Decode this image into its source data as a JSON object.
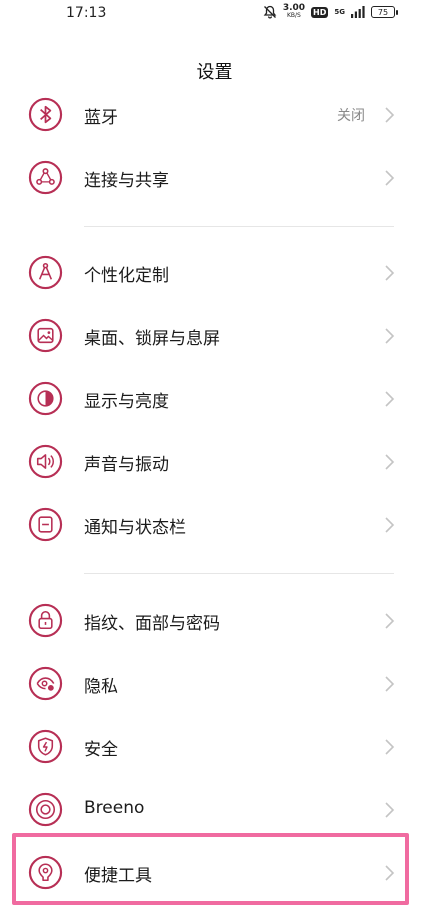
{
  "status": {
    "time": "17:13",
    "speed_value": "3.00",
    "speed_unit": "KB/S",
    "hd": "HD",
    "network": "5G",
    "battery": "75"
  },
  "title": "设置",
  "items": [
    {
      "label": "蓝牙",
      "value": "关闭",
      "icon": "bluetooth-icon"
    },
    {
      "label": "连接与共享",
      "value": "",
      "icon": "share-connect-icon"
    },
    {
      "label": "个性化定制",
      "value": "",
      "icon": "compass-icon"
    },
    {
      "label": "桌面、锁屏与息屏",
      "value": "",
      "icon": "wallpaper-icon"
    },
    {
      "label": "显示与亮度",
      "value": "",
      "icon": "brightness-icon"
    },
    {
      "label": "声音与振动",
      "value": "",
      "icon": "speaker-icon"
    },
    {
      "label": "通知与状态栏",
      "value": "",
      "icon": "notification-icon"
    },
    {
      "label": "指纹、面部与密码",
      "value": "",
      "icon": "lock-icon"
    },
    {
      "label": "隐私",
      "value": "",
      "icon": "privacy-eye-icon"
    },
    {
      "label": "安全",
      "value": "",
      "icon": "shield-icon"
    },
    {
      "label": "Breeno",
      "value": "",
      "icon": "breeno-icon"
    },
    {
      "label": "便捷工具",
      "value": "",
      "icon": "tools-icon"
    }
  ],
  "colors": {
    "icon_accent": "#b72f55",
    "highlight": "#f06ba0"
  }
}
